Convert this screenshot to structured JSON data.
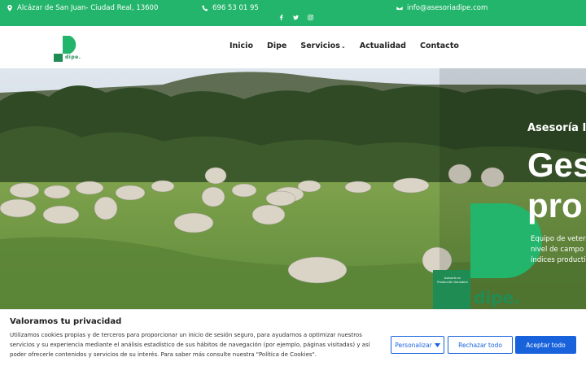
{
  "topbar": {
    "address": "Alcázar de San Juan- Ciudad Real, 13600",
    "phone": "696 53 01 95",
    "email": "info@asesoriadipe.com",
    "icons": [
      "map-marker-icon",
      "phone-icon",
      "envelope-icon",
      "facebook-icon",
      "twitter-icon",
      "instagram-icon"
    ]
  },
  "logo": {
    "text": "dipe."
  },
  "nav": {
    "items": [
      {
        "label": "Inicio"
      },
      {
        "label": "Dipe"
      },
      {
        "label": "Servicios",
        "caret": "⌄"
      },
      {
        "label": "Actualidad"
      },
      {
        "label": "Contacto"
      }
    ]
  },
  "hero": {
    "subtitle": "Asesoría I",
    "title_line1": "Ges",
    "title_line2": "pro",
    "desc_line1": "Equipo de veter",
    "desc_line2": "nivel de campo",
    "desc_line3": "índices producti",
    "sign_text": "Asesoría en Producción Ganadera",
    "sign_logo": "dipe."
  },
  "cookie": {
    "title": "Valoramos tu privacidad",
    "text": "Utilizamos cookies propias y de terceros para proporcionar un inicio de sesión seguro, para ayudarnos a optimizar nuestros servicios y su experiencia mediante el análisis estadístico de sus hábitos de navegación (por ejemplo, páginas visitadas) y así poder ofrecerle contenidos y servicios de su interés. Para saber más consulte nuestra \"Política de Cookies\".",
    "customize_label": "Personalizar",
    "reject_label": "Rechazar todo",
    "accept_label": "Aceptar todo"
  },
  "colors": {
    "brand_green": "#23b56b",
    "button_blue": "#1863dc"
  }
}
